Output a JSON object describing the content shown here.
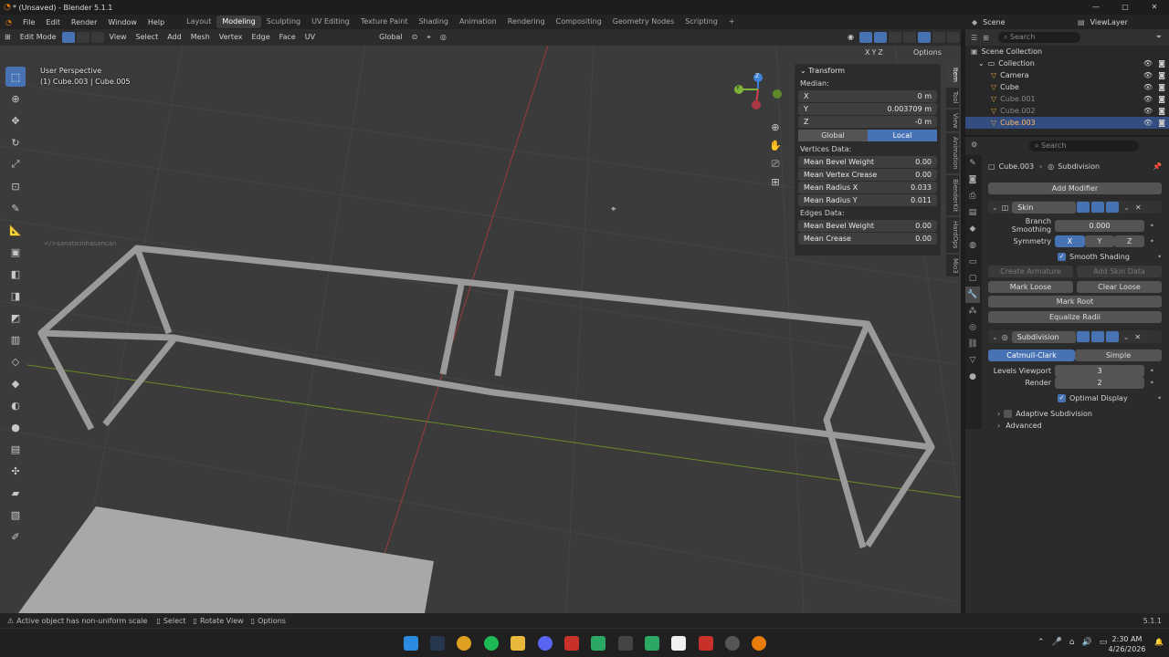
{
  "window": {
    "title": "* (Unsaved) - Blender 5.1.1",
    "min": "—",
    "max": "□",
    "close": "✕"
  },
  "menu": [
    "File",
    "Edit",
    "Render",
    "Window",
    "Help"
  ],
  "workspaces": [
    {
      "label": "Layout",
      "active": false
    },
    {
      "label": "Modeling",
      "active": true
    },
    {
      "label": "Sculpting",
      "active": false
    },
    {
      "label": "UV Editing",
      "active": false
    },
    {
      "label": "Texture Paint",
      "active": false
    },
    {
      "label": "Shading",
      "active": false
    },
    {
      "label": "Animation",
      "active": false
    },
    {
      "label": "Rendering",
      "active": false
    },
    {
      "label": "Compositing",
      "active": false
    },
    {
      "label": "Geometry Nodes",
      "active": false
    },
    {
      "label": "Scripting",
      "active": false
    }
  ],
  "add_workspace": "+",
  "scene": {
    "label": "Scene",
    "layer": "ViewLayer"
  },
  "viewport_header": {
    "mode": "Edit Mode",
    "menus": [
      "View",
      "Select",
      "Add",
      "Mesh",
      "Vertex",
      "Edge",
      "Face",
      "UV"
    ],
    "orientation": "Global",
    "options": "Options",
    "axes": [
      "X",
      "Y",
      "Z"
    ]
  },
  "viewport": {
    "perspective": "User Perspective",
    "objects": "(1) Cube.003 | Cube.005",
    "watermark": "</>sanaticinhasancan"
  },
  "gizmo": {
    "x": "X",
    "y": "Y",
    "z": "Z"
  },
  "npanel": {
    "title": "Transform",
    "median": "Median:",
    "x": {
      "label": "X",
      "value": "0 m"
    },
    "y": {
      "label": "Y",
      "value": "0.003709 m"
    },
    "z": {
      "label": "Z",
      "value": "-0 m"
    },
    "space": [
      "Global",
      "Local"
    ],
    "vertices_title": "Vertices Data:",
    "vertices": [
      {
        "label": "Mean Bevel Weight",
        "value": "0.00"
      },
      {
        "label": "Mean Vertex Crease",
        "value": "0.00"
      },
      {
        "label": "Mean Radius X",
        "value": "0.033"
      },
      {
        "label": "Mean Radius Y",
        "value": "0.011"
      }
    ],
    "edges_title": "Edges Data:",
    "edges": [
      {
        "label": "Mean Bevel Weight",
        "value": "0.00"
      },
      {
        "label": "Mean Crease",
        "value": "0.00"
      }
    ]
  },
  "vtabs": [
    "Item",
    "Tool",
    "View",
    "Animation",
    "BlenderKit",
    "HardOps",
    "Mio3"
  ],
  "outliner": {
    "search": "Search",
    "root": "Scene Collection",
    "collection": "Collection",
    "items": [
      {
        "name": "Camera",
        "selected": false,
        "dim": false
      },
      {
        "name": "Cube",
        "selected": false,
        "dim": false
      },
      {
        "name": "Cube.001",
        "selected": false,
        "dim": true
      },
      {
        "name": "Cube.002",
        "selected": false,
        "dim": true
      },
      {
        "name": "Cube.003",
        "selected": true,
        "dim": false
      }
    ]
  },
  "properties": {
    "search": "Search",
    "breadcrumb_object": "Cube.003",
    "breadcrumb_modifier": "Subdivision",
    "add_modifier": "Add Modifier",
    "skin": {
      "name": "Skin",
      "branch_label": "Branch Smoothing",
      "branch_value": "0.000",
      "symmetry_label": "Symmetry",
      "symmetry": [
        "X",
        "Y",
        "Z"
      ],
      "smooth_shading": "Smooth Shading",
      "create_armature": "Create Armature",
      "add_skin_data": "Add Skin Data",
      "mark_loose": "Mark Loose",
      "clear_loose": "Clear Loose",
      "mark_root": "Mark Root",
      "equalize_radii": "Equalize Radii"
    },
    "subdivision": {
      "name": "Subdivision",
      "types": [
        "Catmull-Clark",
        "Simple"
      ],
      "levels_label": "Levels Viewport",
      "levels_value": "3",
      "render_label": "Render",
      "render_value": "2",
      "optimal": "Optimal Display",
      "adaptive": "Adaptive Subdivision",
      "advanced": "Advanced"
    }
  },
  "status": {
    "msg": "Active object has non-uniform scale",
    "select": "Select",
    "rotate": "Rotate View",
    "options": "Options",
    "version": "5.1.1"
  },
  "clock": {
    "time": "2:30 AM",
    "date": "4/26/2026"
  },
  "colors": {
    "accent": "#4772b3",
    "axis_x": "#d6404d",
    "axis_y": "#7fb23a",
    "axis_z": "#3d82d9"
  }
}
